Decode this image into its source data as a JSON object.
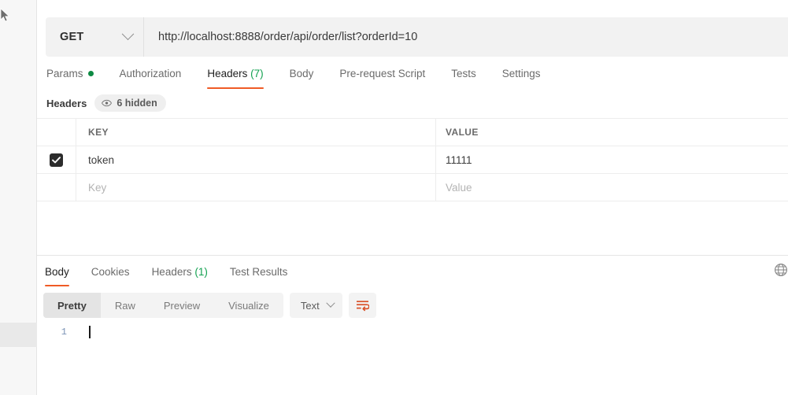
{
  "request": {
    "method": "GET",
    "method_icon": "chevron-down-icon",
    "url": "http://localhost:8888/order/api/order/list?orderId=10",
    "tabs": [
      {
        "label": "Params",
        "badge": "",
        "dot": true,
        "active": false
      },
      {
        "label": "Authorization",
        "badge": "",
        "dot": false,
        "active": false
      },
      {
        "label": "Headers",
        "badge": "(7)",
        "dot": false,
        "active": true
      },
      {
        "label": "Body",
        "badge": "",
        "dot": false,
        "active": false
      },
      {
        "label": "Pre-request Script",
        "badge": "",
        "dot": false,
        "active": false
      },
      {
        "label": "Tests",
        "badge": "",
        "dot": false,
        "active": false
      },
      {
        "label": "Settings",
        "badge": "",
        "dot": false,
        "active": false
      }
    ],
    "headers_panel": {
      "title": "Headers",
      "hidden_pill": "6 hidden",
      "hidden_icon": "eye-icon",
      "columns": [
        "KEY",
        "VALUE"
      ],
      "rows": [
        {
          "checked": true,
          "key": "token",
          "value": "11111",
          "placeholder": false
        },
        {
          "checked": false,
          "key": "Key",
          "value": "Value",
          "placeholder": true
        }
      ]
    }
  },
  "response": {
    "tabs": [
      {
        "label": "Body",
        "badge": "",
        "active": true
      },
      {
        "label": "Cookies",
        "badge": "",
        "active": false
      },
      {
        "label": "Headers",
        "badge": "(1)",
        "active": false
      },
      {
        "label": "Test Results",
        "badge": "",
        "active": false
      }
    ],
    "globe_icon": "globe-icon",
    "format": {
      "segments": [
        {
          "label": "Pretty",
          "active": true
        },
        {
          "label": "Raw",
          "active": false
        },
        {
          "label": "Preview",
          "active": false
        },
        {
          "label": "Visualize",
          "active": false
        }
      ],
      "language": "Text",
      "language_icon": "chevron-down-icon",
      "wrap_icon": "wrap-text-icon"
    },
    "body_editor": {
      "lines": [
        {
          "number": "1",
          "text": ""
        }
      ]
    }
  },
  "colors": {
    "accent": "#ef5b25",
    "green": "#0e8a43",
    "count_green": "#12a150",
    "panel_bg": "#f2f2f2"
  }
}
